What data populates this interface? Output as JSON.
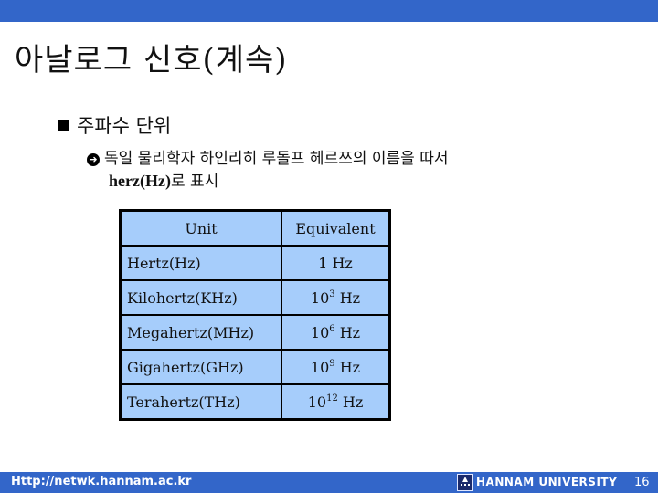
{
  "slide": {
    "title": "아날로그 신호(계속)",
    "bullet": {
      "label": "주파수 단위",
      "icon": "square-bullet-icon",
      "sub": {
        "icon": "arrow-circle-icon",
        "icon_glyph": "➲",
        "line1": "독일 물리학자 하인리히 루돌프 헤르쯔의 이름을 따서",
        "line2_bold": "herz(Hz)",
        "line2_rest": "로 표시"
      }
    },
    "table": {
      "headers": [
        "Unit",
        "Equivalent"
      ],
      "rows": [
        {
          "unit": "Hertz(Hz)",
          "base": "1 Hz",
          "exp": "",
          "suffix": ""
        },
        {
          "unit": "Kilohertz(KHz)",
          "base": "10",
          "exp": "3",
          "suffix": " Hz"
        },
        {
          "unit": "Megahertz(MHz)",
          "base": "10",
          "exp": "6",
          "suffix": " Hz"
        },
        {
          "unit": "Gigahertz(GHz)",
          "base": "10",
          "exp": "9",
          "suffix": " Hz"
        },
        {
          "unit": "Terahertz(THz)",
          "base": "10",
          "exp": "12",
          "suffix": " Hz"
        }
      ]
    }
  },
  "footer": {
    "url": "Http://netwk.hannam.ac.kr",
    "logo_icon": "university-logo-icon",
    "university": "HANNAM UNIVERSITY",
    "page_number": "16"
  },
  "colors": {
    "bar": "#3366c9",
    "table_fill": "#a6cdfb",
    "text": "#111111"
  }
}
